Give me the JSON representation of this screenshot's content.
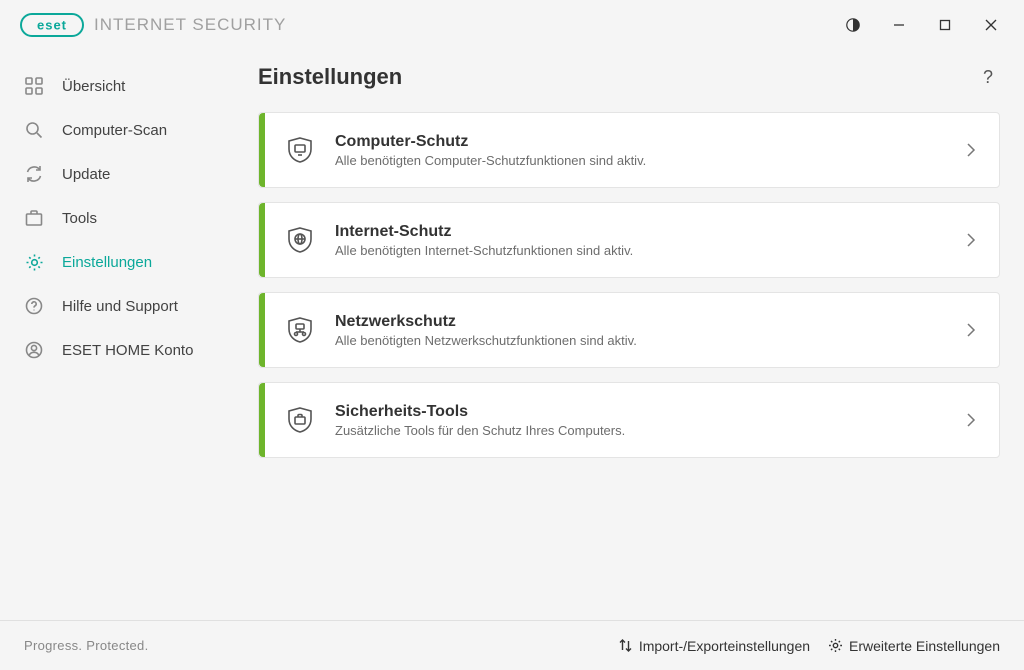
{
  "header": {
    "product": "INTERNET SECURITY",
    "logo_text": "eset"
  },
  "sidebar": {
    "items": [
      {
        "label": "Übersicht"
      },
      {
        "label": "Computer-Scan"
      },
      {
        "label": "Update"
      },
      {
        "label": "Tools"
      },
      {
        "label": "Einstellungen"
      },
      {
        "label": "Hilfe und Support"
      },
      {
        "label": "ESET HOME Konto"
      }
    ]
  },
  "page": {
    "title": "Einstellungen",
    "help": "?"
  },
  "cards": [
    {
      "title": "Computer-Schutz",
      "sub": "Alle benötigten Computer-Schutzfunktionen sind aktiv."
    },
    {
      "title": "Internet-Schutz",
      "sub": "Alle benötigten Internet-Schutzfunktionen sind aktiv."
    },
    {
      "title": "Netzwerkschutz",
      "sub": "Alle benötigten Netzwerkschutzfunktionen sind aktiv."
    },
    {
      "title": "Sicherheits-Tools",
      "sub": "Zusätzliche Tools für den Schutz Ihres Computers."
    }
  ],
  "footer": {
    "tagline": "Progress. Protected.",
    "import": "Import-/Exporteinstellungen",
    "advanced": "Erweiterte Einstellungen"
  }
}
